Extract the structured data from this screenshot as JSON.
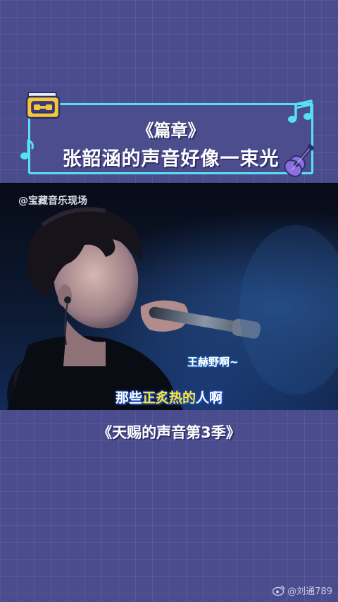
{
  "title_card": {
    "line1": "《篇章》",
    "line2": "张韶涵的声音好像一束光"
  },
  "video": {
    "watermark": "@宝藏音乐现场",
    "subtitle_name": "王赫野啊~",
    "subtitle_before": "那些",
    "subtitle_highlight": "正炙热的",
    "subtitle_after": "人啊"
  },
  "show_name": "《天赐的声音第3季》",
  "credit": {
    "text": "@刘通789",
    "icon": "weibo-icon"
  },
  "colors": {
    "background": "#4a4c8e",
    "card_border": "#57e1f0",
    "subtitle_highlight": "#ffe533",
    "radio_icon": "#f4c63a",
    "guitar_icon": "#8a6fe0"
  }
}
